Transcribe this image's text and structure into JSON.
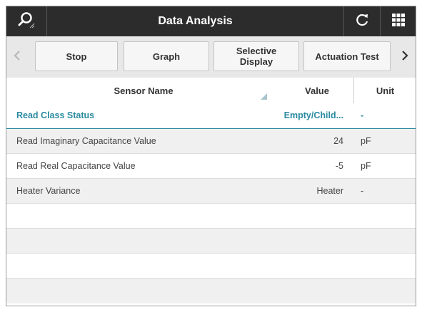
{
  "title": "Data Analysis",
  "toolbar": {
    "buttons": [
      "Stop",
      "Graph",
      "Selective\nDisplay",
      "Actuation Test"
    ]
  },
  "table": {
    "headers": {
      "name": "Sensor Name",
      "value": "Value",
      "unit": "Unit"
    },
    "rows": [
      {
        "name": "Read Class Status",
        "value": "Empty/Child...",
        "unit": "-"
      },
      {
        "name": "Read Imaginary Capacitance Value",
        "value": "24",
        "unit": "pF"
      },
      {
        "name": "Read Real Capacitance Value",
        "value": "-5",
        "unit": "pF"
      },
      {
        "name": "Heater Variance",
        "value": "Heater",
        "unit": "-"
      },
      {
        "name": "",
        "value": "",
        "unit": ""
      },
      {
        "name": "",
        "value": "",
        "unit": ""
      },
      {
        "name": "",
        "value": "",
        "unit": ""
      },
      {
        "name": "",
        "value": "",
        "unit": ""
      }
    ]
  },
  "icons": {
    "search": "search-icon",
    "refresh": "refresh-icon",
    "menu": "grid-menu-icon",
    "left": "chevron-left-icon",
    "right": "chevron-right-icon"
  },
  "colors": {
    "titlebar": "#2c2c2c",
    "accent": "#2a8aa0",
    "toolbar": "#e8e8e8",
    "stripe": "#f0f0f0"
  }
}
